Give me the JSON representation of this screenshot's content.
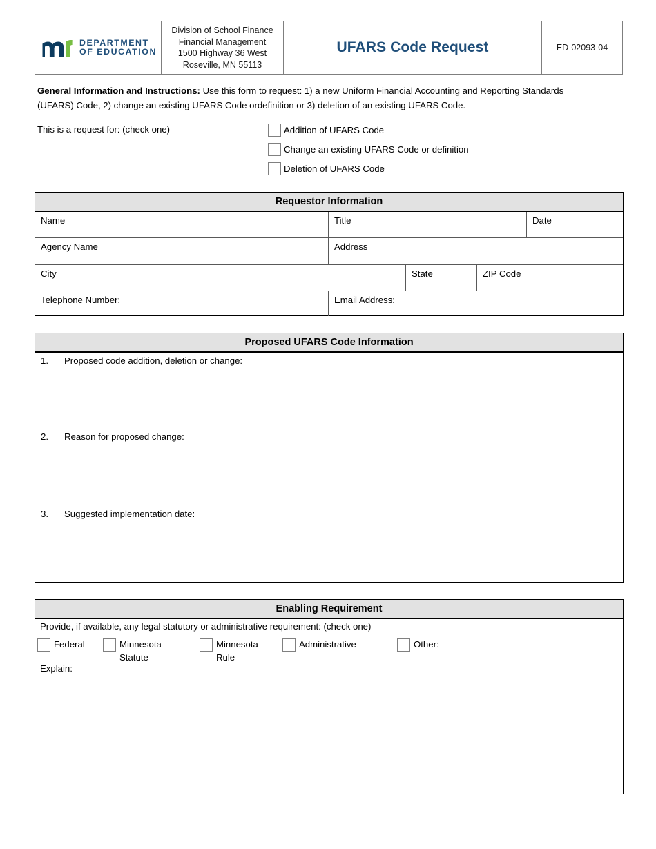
{
  "header": {
    "logo_alt": "Minnesota Department of Education",
    "logo_line1": "DEPARTMENT",
    "logo_line2": "OF EDUCATION",
    "logo_colors": {
      "navy": "#0c3b5e",
      "green": "#78be43"
    },
    "address_lines": [
      "Division of School Finance",
      "Financial Management",
      "1500 Highway 36 West",
      "Roseville, MN 55113"
    ],
    "title": "UFARS Code Request",
    "title_color": "#1f4e79",
    "form_id": "ED-02093-04"
  },
  "instructions": {
    "label": "General Information and Instructions:",
    "body": " Use this form to request: 1) a new Uniform Financial Accounting and Reporting Standards (UFARS) Code, 2) change an existing UFARS Code ordefinition or 3) deletion of an existing UFARS Code."
  },
  "request_for": {
    "label": "This is a request for: (check one)",
    "options": [
      {
        "label": "Addition of UFARS Code",
        "checked": false
      },
      {
        "label": "Change an existing UFARS Code or definition",
        "checked": false
      },
      {
        "label": "Deletion of UFARS Code",
        "checked": false
      }
    ]
  },
  "requestor_information": {
    "heading": "Requestor Information",
    "rows": [
      [
        {
          "label": "Name",
          "value": ""
        },
        {
          "label": "Title",
          "value": ""
        },
        {
          "label": "Date",
          "value": ""
        }
      ],
      [
        {
          "label": "Agency Name",
          "value": ""
        },
        {
          "label": "Address",
          "value": ""
        }
      ],
      [
        {
          "label": "City",
          "value": ""
        },
        {
          "label": "State",
          "value": ""
        },
        {
          "label": "ZIP Code",
          "value": ""
        }
      ],
      [
        {
          "label": "Telephone Number:",
          "value": ""
        },
        {
          "label": "Email Address:",
          "value": ""
        }
      ]
    ]
  },
  "proposed_information": {
    "heading": "Proposed UFARS Code Information",
    "items": [
      {
        "number": "1.",
        "label": "Proposed code addition, deletion or change:",
        "value": ""
      },
      {
        "number": "2.",
        "label": "Reason for proposed change:",
        "value": ""
      },
      {
        "number": "3.",
        "label": "Suggested implementation date:",
        "value": ""
      }
    ]
  },
  "enabling_requirement": {
    "heading": "Enabling Requirement",
    "intro": "Provide, if available, any legal statutory or administrative requirement: (check one)",
    "options": [
      {
        "label": "Federal",
        "checked": false
      },
      {
        "label": "Minnesota Statute",
        "checked": false
      },
      {
        "label": "Minnesota Rule",
        "checked": false
      },
      {
        "label": "Administrative",
        "checked": false
      },
      {
        "label": "Other:",
        "checked": false
      }
    ],
    "other_value": "",
    "explain_label": "Explain:",
    "explain_value": ""
  }
}
